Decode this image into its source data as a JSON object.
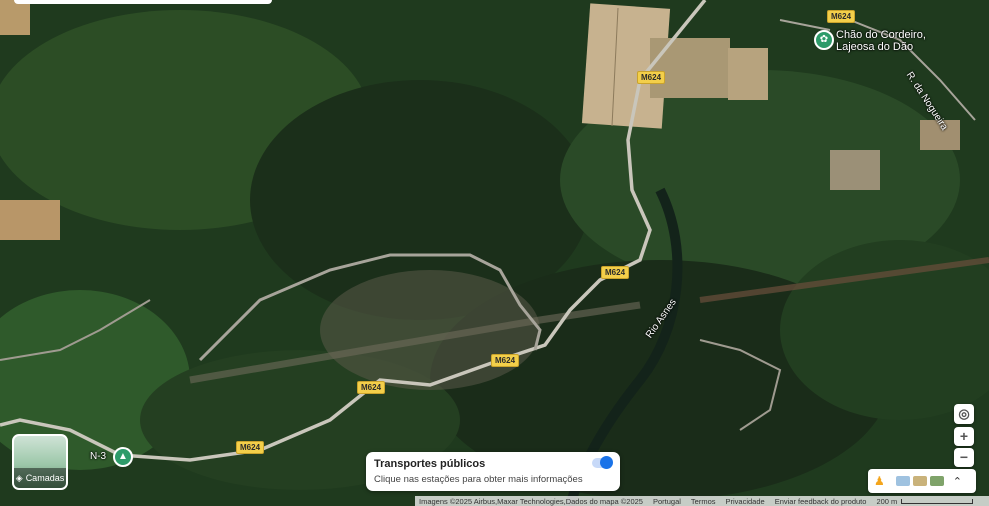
{
  "map": {
    "road_labels": [
      {
        "id": "m624-1",
        "text": "M624"
      },
      {
        "id": "m624-2",
        "text": "M624"
      },
      {
        "id": "m624-3",
        "text": "M624"
      },
      {
        "id": "m624-4",
        "text": "M624"
      },
      {
        "id": "m624-5",
        "text": "M624"
      },
      {
        "id": "m624-6",
        "text": "M624"
      }
    ],
    "places": {
      "poi_line1": "Chão do Cordeiro,",
      "poi_line2": "Lajeosa do Dão",
      "river": "Rio Asnes",
      "road_nogueira": "R. da Nogueira",
      "n3": "N-3"
    }
  },
  "layers_button": {
    "label": "Camadas"
  },
  "transit_card": {
    "title": "Transportes públicos",
    "subtitle": "Clique nas estações para obter mais informações"
  },
  "controls": {
    "zoom_in": "+",
    "zoom_out": "−"
  },
  "attribution": {
    "imagery": "Imagens ©2025 Airbus,Maxar Technologies,Dados do mapa ©2025",
    "country": "Portugal",
    "terms": "Termos",
    "privacy": "Privacidade",
    "feedback": "Enviar feedback do produto",
    "scale": "200 m"
  },
  "icons": {
    "layers": "layers-icon",
    "locate": "my-location-icon",
    "pegman": "pegman-icon",
    "expand": "chevron-up-icon",
    "poi": "leaf-poi-icon",
    "tree": "tree-poi-icon"
  }
}
